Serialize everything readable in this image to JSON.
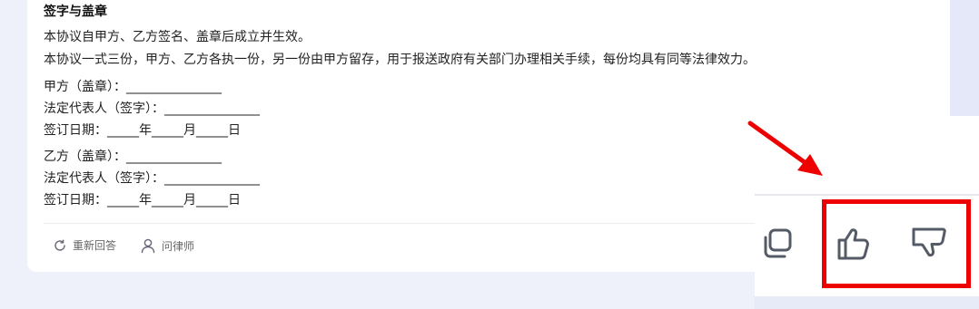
{
  "document": {
    "section_title": "签字与盖章",
    "paragraphs": [
      "本协议自甲方、乙方签名、盖章后成立并生效。",
      "本协议一式三份，甲方、乙方各执一份，另一份由甲方留存，用于报送政府有关部门办理相关手续，每份均具有同等法律效力。"
    ],
    "party_a": {
      "seal": "甲方（盖章）：_______________",
      "representative": "法定代表人（签字）：_______________",
      "date": "签订日期：_____年_____月_____日"
    },
    "party_b": {
      "seal": "乙方（盖章）：_______________",
      "representative": "法定代表人（签字）：_______________",
      "date": "签订日期：_____年_____月_____日"
    }
  },
  "actions": {
    "regenerate_label": "重新回答",
    "ask_lawyer_label": "问律师",
    "regenerate_icon": "refresh-icon",
    "ask_lawyer_icon": "user-icon"
  },
  "zoom_panel": {
    "icons": [
      "copy-icon",
      "thumbs-up-icon",
      "thumbs-down-icon"
    ]
  },
  "annotation": {
    "highlight_color": "#ee0000",
    "arrow_color": "#ee0000"
  },
  "colors": {
    "background": "#eef1fa",
    "card": "#ffffff",
    "icon_gray": "#555b66"
  }
}
